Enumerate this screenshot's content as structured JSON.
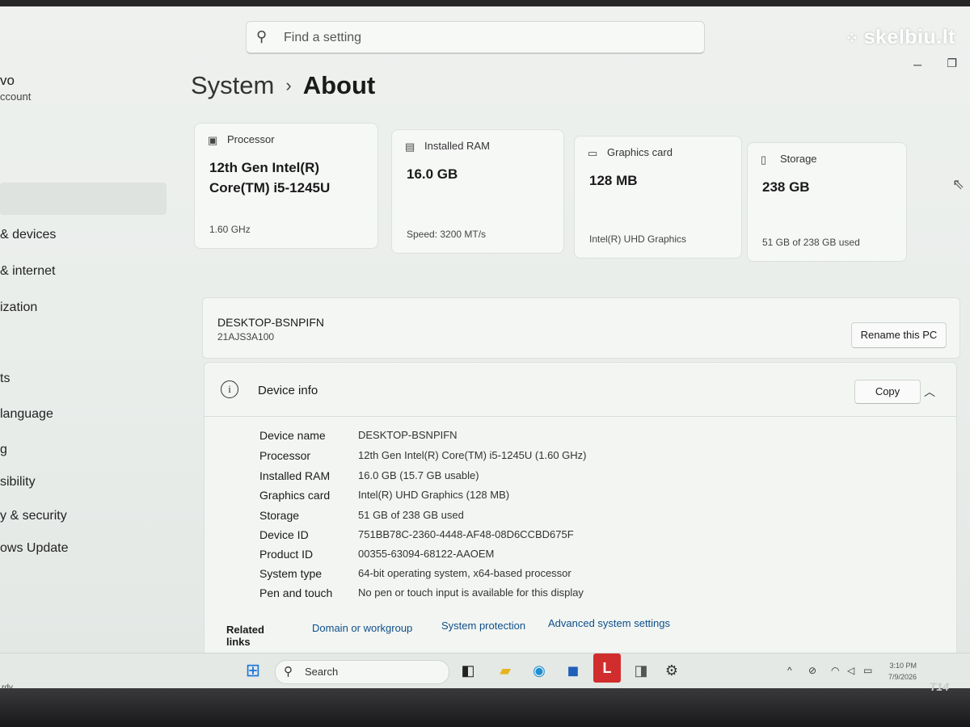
{
  "watermark": "skelbiu.lt",
  "sidebar": {
    "account_name": "vo",
    "account_sub": "ccount",
    "items": [
      {
        "label": "& devices"
      },
      {
        "label": "& internet"
      },
      {
        "label": "ization"
      },
      {
        "label": "ts"
      },
      {
        "label": " language"
      },
      {
        "label": "g"
      },
      {
        "label": "sibility"
      },
      {
        "label": "y & security"
      },
      {
        "label": "ows Update"
      }
    ]
  },
  "search": {
    "placeholder": "Find a setting"
  },
  "breadcrumb": {
    "parent": "System",
    "separator": "›",
    "current": "About"
  },
  "cards": [
    {
      "label": "Processor",
      "value": "12th Gen Intel(R) Core(TM) i5-1245U",
      "sub": "1.60 GHz"
    },
    {
      "label": "Installed RAM",
      "value": "16.0 GB",
      "sub": "Speed: 3200 MT/s"
    },
    {
      "label": "Graphics card",
      "value": "128 MB",
      "sub": "Intel(R) UHD Graphics"
    },
    {
      "label": "Storage",
      "value": "238 GB",
      "sub": "51 GB of 238 GB used"
    }
  ],
  "pc": {
    "name": "DESKTOP-BSNPIFN",
    "model": "21AJS3A100",
    "rename_label": "Rename this PC"
  },
  "device_info": {
    "title": "Device info",
    "copy_label": "Copy",
    "specs": [
      {
        "key": "Device name",
        "value": "DESKTOP-BSNPIFN"
      },
      {
        "key": "Processor",
        "value": "12th Gen Intel(R) Core(TM) i5-1245U (1.60 GHz)"
      },
      {
        "key": "Installed RAM",
        "value": "16.0 GB (15.7 GB usable)"
      },
      {
        "key": "Graphics card",
        "value": "Intel(R) UHD Graphics (128 MB)"
      },
      {
        "key": "Storage",
        "value": "51 GB of 238 GB used"
      },
      {
        "key": "Device ID",
        "value": "751BB78C-2360-4448-AF48-08D6CCBD675F"
      },
      {
        "key": "Product ID",
        "value": "00355-63094-68122-AAOEM"
      },
      {
        "key": "System type",
        "value": "64-bit operating system, x64-based processor"
      },
      {
        "key": "Pen and touch",
        "value": "No pen or touch input is available for this display"
      }
    ]
  },
  "related": {
    "heading": "Related links",
    "links": [
      "Domain or workgroup",
      "System protection",
      "Advanced system settings"
    ]
  },
  "taskbar": {
    "search_label": "Search",
    "clock_time": "3:10 PM",
    "clock_date": "7/9/2026",
    "pinned_app_letter": "L"
  },
  "laptop_model": "T14",
  "corner_text": "rdy"
}
